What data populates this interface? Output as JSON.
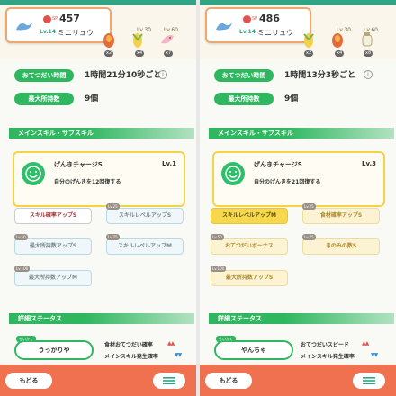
{
  "panels": [
    {
      "pokemon": {
        "sp_label": "SP",
        "sp_value": "457",
        "level": "Lv.14",
        "name": "ミニリュウ"
      },
      "foods": [
        {
          "level": "",
          "count": "x2"
        },
        {
          "level": "Lv.30",
          "count": "x4"
        },
        {
          "level": "Lv.60",
          "count": "x7"
        }
      ],
      "help_time_label": "おてつだい時間",
      "help_time_value": "1時間21分10秒ごと",
      "max_carry_label": "最大所持数",
      "max_carry_value": "9個",
      "skill_section_title": "メインスキル・サブスキル",
      "main_skill": {
        "name": "げんきチャージS",
        "level": "Lv.1",
        "description": "自分のげんきを12回復する"
      },
      "subskills": [
        {
          "label": "スキル確率アップS",
          "tag": "",
          "style": "white"
        },
        {
          "label": "スキルレベルアップS",
          "tag": "Lv.25",
          "style": "blue"
        },
        {
          "label": "最大所持数アップS",
          "tag": "Lv.50",
          "style": "blue"
        },
        {
          "label": "スキルレベルアップM",
          "tag": "Lv.75",
          "style": "blue"
        },
        {
          "label": "最大所持数アップM",
          "tag": "Lv.100",
          "style": "blue"
        }
      ],
      "status_section_title": "詳細ステータス",
      "nature_tag": "せいかく",
      "nature": "うっかりや",
      "stat_up_label": "食材おてつだい確率",
      "stat_up_arrows": "▲▲",
      "stat_down_label": "メインスキル発生確率",
      "stat_down_arrows": "▼▼",
      "back_label": "もどる"
    },
    {
      "pokemon": {
        "sp_label": "SP",
        "sp_value": "486",
        "level": "Lv.14",
        "name": "ミニリュウ"
      },
      "foods": [
        {
          "level": "",
          "count": "x2"
        },
        {
          "level": "Lv.30",
          "count": "x4"
        },
        {
          "level": "Lv.60",
          "count": "x8"
        }
      ],
      "help_time_label": "おてつだい時間",
      "help_time_value": "1時間13分3秒ごと",
      "max_carry_label": "最大所持数",
      "max_carry_value": "9個",
      "skill_section_title": "メインスキル・サブスキル",
      "main_skill": {
        "name": "げんきチャージS",
        "level": "Lv.3",
        "description": "自分のげんきを21回復する"
      },
      "subskills": [
        {
          "label": "スキルレベルアップM",
          "tag": "",
          "style": "yellow-active"
        },
        {
          "label": "食材確率アップS",
          "tag": "Lv.25",
          "style": "yellow"
        },
        {
          "label": "おてつだいボーナス",
          "tag": "Lv.50",
          "style": "yellow"
        },
        {
          "label": "きのみの数S",
          "tag": "Lv.75",
          "style": "yellow"
        },
        {
          "label": "最大所持数アップS",
          "tag": "Lv.100",
          "style": "yellow"
        }
      ],
      "status_section_title": "詳細ステータス",
      "nature_tag": "せいかく",
      "nature": "やんちゃ",
      "stat_up_label": "おてつだいスピード",
      "stat_up_arrows": "▲▲",
      "stat_down_label": "メインスキル発生確率",
      "stat_down_arrows": "▼▼",
      "back_label": "もどる"
    }
  ],
  "icons": [
    "info-icon",
    "food-icon",
    "smile-icon",
    "menu-icon",
    "dragon-icon"
  ],
  "colors": {
    "accent_green": "#2fb75f",
    "card_border_orange": "#f0a76e",
    "bottom_bar": "#f0714f",
    "skill_yellow": "#f7d84d",
    "stat_up_red": "#e0524a",
    "stat_down_blue": "#3a8fd8"
  }
}
